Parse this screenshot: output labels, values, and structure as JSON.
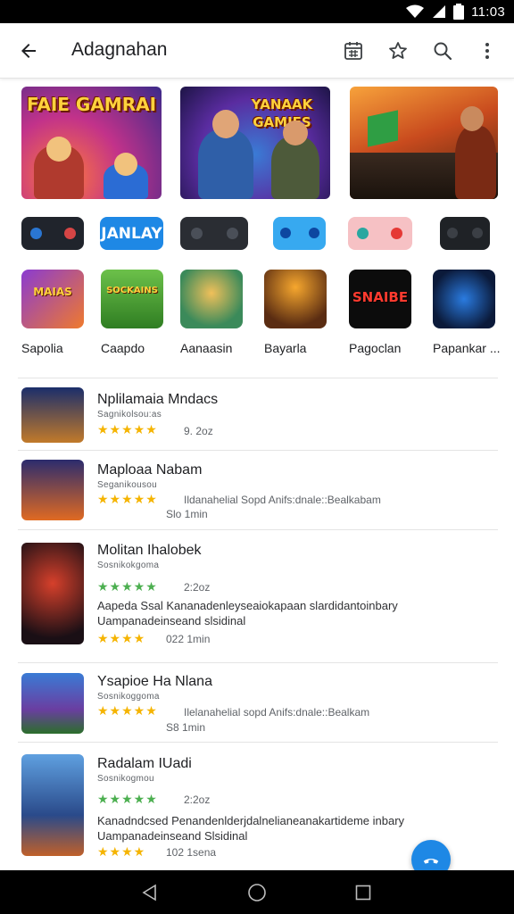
{
  "status_bar": {
    "time": "11:03"
  },
  "app_bar": {
    "title": "Adagnahan"
  },
  "banners": [
    {
      "text": "FAIE GAMRAI"
    },
    {
      "text": "YANAAK GAMIES"
    },
    {
      "text": ""
    }
  ],
  "controllers": [
    {
      "label": ""
    },
    {
      "label": "JANLAY"
    },
    {
      "label": ""
    },
    {
      "label": ""
    },
    {
      "label": ""
    },
    {
      "label": ""
    }
  ],
  "categories": [
    {
      "label": "Sapolia",
      "tile_text": "MAIAS"
    },
    {
      "label": "Caapdo",
      "tile_text": "SOCKAINS"
    },
    {
      "label": "Aanaasin",
      "tile_text": ""
    },
    {
      "label": "Bayarla",
      "tile_text": ""
    },
    {
      "label": "Pagoclan",
      "tile_text": "SNAIBE"
    },
    {
      "label": "Papankar ...",
      "tile_text": ""
    }
  ],
  "list": [
    {
      "title": "Nplilamaia Mndacs",
      "sub": "Sagnikolsou:as",
      "stars": "★★★★★",
      "meta": "9. 2oz",
      "desc": "",
      "desc2": "",
      "stars2": "",
      "meta2": ""
    },
    {
      "title": "Maploaa Nabam",
      "sub": "Seganikousou",
      "stars": "★★★★★",
      "meta": "Ildanahelial Sopd Anifs:dnale::Bealkabam",
      "meta_line2": "Slo 1min",
      "desc": "",
      "desc2": "",
      "stars2": "",
      "meta2": ""
    },
    {
      "title": "Molitan Ihalobek",
      "sub": "Sosnikokgoma",
      "stars": "★★★★★",
      "meta": "2:2oz",
      "desc": "Aapeda Ssal Kananadenleyseaiokapaan slardidantoinbary",
      "desc2": "Uampanadeinseand slsidinal",
      "stars2": "★★★★",
      "meta2": "022 1min"
    },
    {
      "title": "Ysapioe Ha Nlana",
      "sub": "Sosnikoggoma",
      "stars": "★★★★★",
      "meta": "Ilelanahelial sopd Anifs:dnale::Bealkam",
      "meta_line2": "S8 1min",
      "desc": "",
      "desc2": "",
      "stars2": "",
      "meta2": ""
    },
    {
      "title": "Radalam IUadi",
      "sub": "Sosnikogmou",
      "stars": "★★★★★",
      "meta": "2:2oz",
      "desc": "Kanadndcsed Penandenlderjdalnelianeanakartideme inbary",
      "desc2": "Uampanadeinseand Slsidinal",
      "stars2": "★★★★",
      "meta2": "102 1sena"
    }
  ]
}
